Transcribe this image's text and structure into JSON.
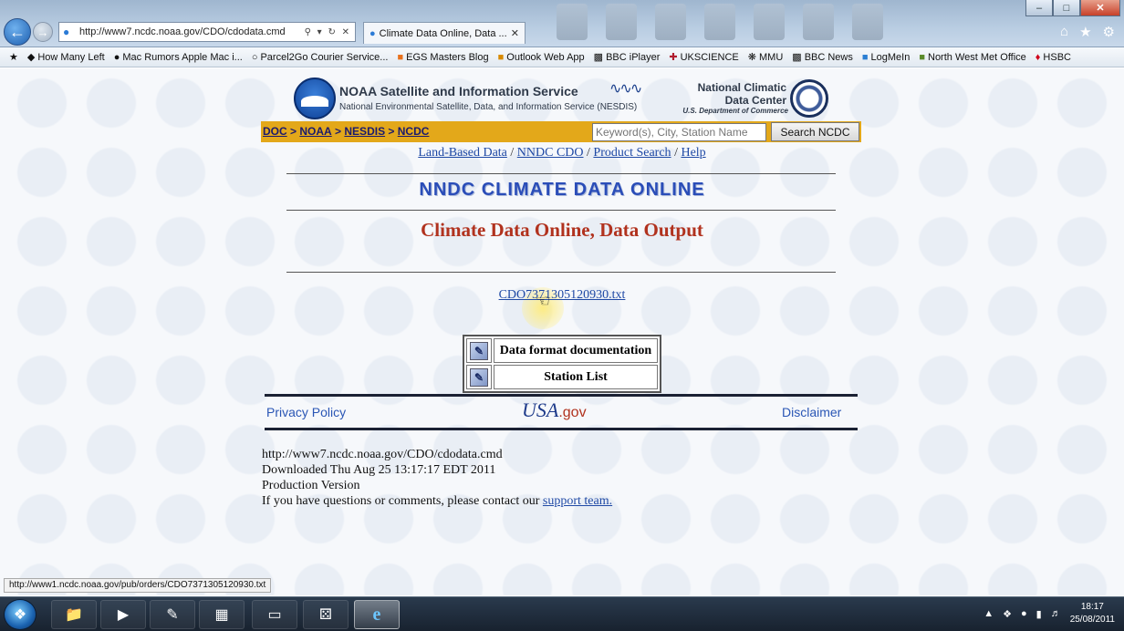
{
  "browser": {
    "address_url": "http://www7.ncdc.noaa.gov/CDO/cdodata.cmd",
    "tab_title": "Climate Data Online, Data ...",
    "favorites": [
      "How Many Left",
      "Mac Rumors Apple Mac i...",
      "Parcel2Go Courier Service...",
      "EGS Masters Blog",
      "Outlook Web App",
      "BBC iPlayer",
      "UKSCIENCE",
      "MMU",
      "BBC News",
      "LogMeIn",
      "North West Met Office",
      "HSBC"
    ]
  },
  "header": {
    "title": "NOAA Satellite and Information Service",
    "subtitle": "National Environmental Satellite, Data, and Information Service (NESDIS)",
    "ncdc_line1": "National Climatic",
    "ncdc_line2": "Data Center",
    "ncdc_line3": "U.S. Department of Commerce"
  },
  "breadcrumb": [
    "DOC",
    "NOAA",
    "NESDIS",
    "NCDC"
  ],
  "search": {
    "placeholder": "Keyword(s), City, Station Name",
    "button": "Search NCDC"
  },
  "subnav": [
    "Land-Based Data",
    "NNDC CDO",
    "Product Search",
    "Help"
  ],
  "main": {
    "heading": "NNDC CLIMATE DATA ONLINE",
    "subheading": "Climate Data Online, Data Output",
    "file_link": "CDO7371305120930.txt",
    "doc_rows": [
      "Data format documentation",
      "Station List"
    ]
  },
  "footer": {
    "privacy": "Privacy Policy",
    "usagov": "USA",
    "usagov_suffix": ".gov",
    "disclaimer": "Disclaimer",
    "url_line": "http://www7.ncdc.noaa.gov/CDO/cdodata.cmd",
    "downloaded": "Downloaded Thu Aug 25 13:17:17 EDT 2011",
    "version": "Production Version",
    "contact_text": "If you have questions or comments, please contact our",
    "contact_link": "support team."
  },
  "status_url": "http://www1.ncdc.noaa.gov/pub/orders/CDO7371305120930.txt",
  "taskbar": {
    "time": "18:17",
    "date": "25/08/2011"
  }
}
